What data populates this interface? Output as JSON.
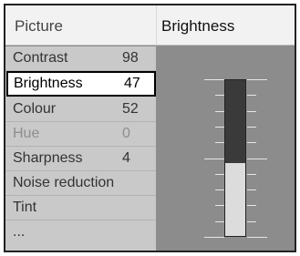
{
  "header": {
    "menu_title": "Picture",
    "setting_title": "Brightness"
  },
  "menu": {
    "items": [
      {
        "label": "Contrast",
        "value": "98",
        "state": "normal"
      },
      {
        "label": "Brightness",
        "value": "47",
        "state": "selected"
      },
      {
        "label": "Colour",
        "value": "52",
        "state": "normal"
      },
      {
        "label": "Hue",
        "value": "0",
        "state": "disabled"
      },
      {
        "label": "Sharpness",
        "value": "4",
        "state": "normal"
      },
      {
        "label": "Noise reduction",
        "value": "",
        "state": "normal"
      },
      {
        "label": "Tint",
        "value": "",
        "state": "normal"
      },
      {
        "label": "...",
        "value": "",
        "state": "normal"
      }
    ]
  },
  "slider": {
    "level": 0.47
  },
  "colors": {
    "selected_bg": "#ffffff",
    "menu_bg": "#c9c9c9",
    "panel_bg": "#8c8c8c",
    "track_dark": "#3a3a3a",
    "track_fill": "#dcdcdc"
  }
}
